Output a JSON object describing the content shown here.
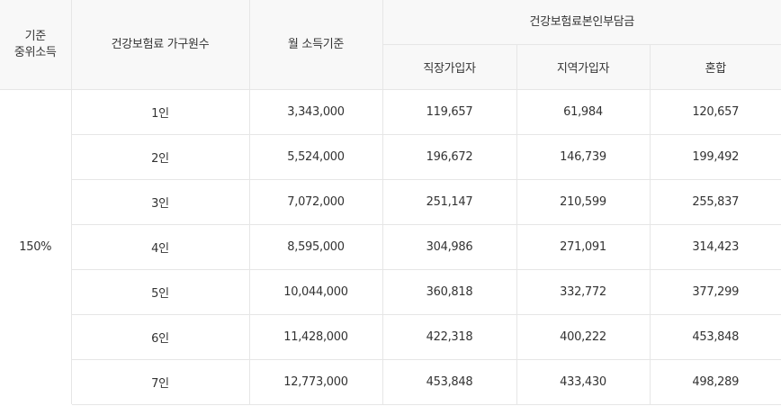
{
  "header": {
    "criteria_line1": "기준",
    "criteria_line2": "중위소득",
    "household": "건강보험료 가구원수",
    "income": "월 소득기준",
    "premium_group": "건강보험료본인부담금",
    "workplace": "직장가입자",
    "regional": "지역가입자",
    "mixed": "혼합"
  },
  "criteria_value": "150%",
  "rows": [
    {
      "household": "1인",
      "income": "3,343,000",
      "workplace": "119,657",
      "regional": "61,984",
      "mixed": "120,657"
    },
    {
      "household": "2인",
      "income": "5,524,000",
      "workplace": "196,672",
      "regional": "146,739",
      "mixed": "199,492"
    },
    {
      "household": "3인",
      "income": "7,072,000",
      "workplace": "251,147",
      "regional": "210,599",
      "mixed": "255,837"
    },
    {
      "household": "4인",
      "income": "8,595,000",
      "workplace": "304,986",
      "regional": "271,091",
      "mixed": "314,423"
    },
    {
      "household": "5인",
      "income": "10,044,000",
      "workplace": "360,818",
      "regional": "332,772",
      "mixed": "377,299"
    },
    {
      "household": "6인",
      "income": "11,428,000",
      "workplace": "422,318",
      "regional": "400,222",
      "mixed": "453,848"
    },
    {
      "household": "7인",
      "income": "12,773,000",
      "workplace": "453,848",
      "regional": "433,430",
      "mixed": "498,289"
    }
  ]
}
